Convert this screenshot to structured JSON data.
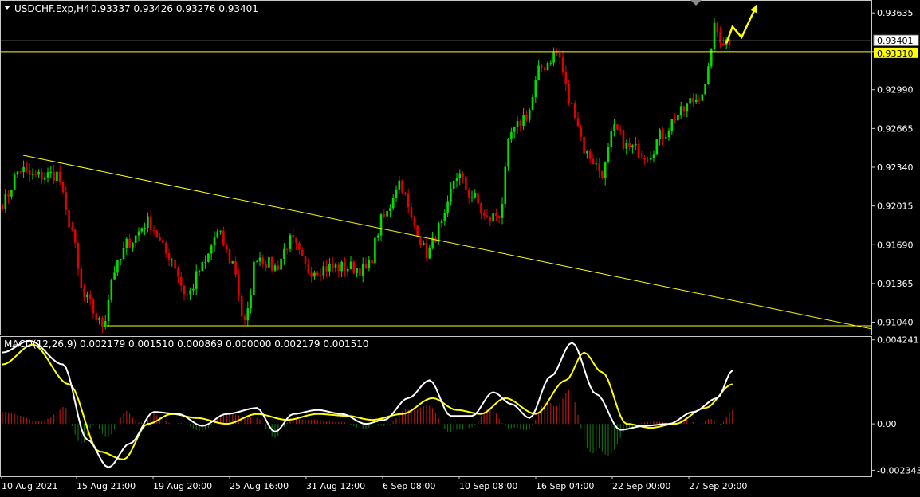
{
  "header": {
    "symbol": "USDCHF.Exp,H4",
    "ohlc": "0.93337 0.93426 0.93276 0.93401"
  },
  "colors": {
    "background": "#000000",
    "bull": "#00e000",
    "bear": "#e00000",
    "trend": "#ffff00",
    "grid": "#c8c8c8",
    "macd_line": "#ffffff",
    "signal_line": "#ffff00",
    "hist_pos": "#b01515",
    "hist_neg": "#0e6a0e"
  },
  "chart_data": [
    {
      "type": "candlestick",
      "name": "USDCHF.Exp,H4",
      "x_labels": [
        "10 Aug 2021",
        "15 Aug 21:00",
        "19 Aug 20:00",
        "25 Aug 16:00",
        "31 Aug 12:00",
        "6 Sep 08:00",
        "10 Sep 08:00",
        "16 Sep 04:00",
        "22 Sep 00:00",
        "27 Sep 20:00"
      ],
      "y_ticks": [
        "0.93635",
        "0.93310",
        "0.92990",
        "0.92665",
        "0.92340",
        "0.92015",
        "0.91690",
        "0.91365",
        "0.91040"
      ],
      "ylim": [
        0.9095,
        0.9373
      ],
      "bid_price": "0.93401",
      "level_price": "0.93310",
      "anchors": [
        [
          0,
          0.9205
        ],
        [
          6,
          0.9232
        ],
        [
          10,
          0.9226
        ],
        [
          18,
          0.9228
        ],
        [
          22,
          0.9188
        ],
        [
          27,
          0.9124
        ],
        [
          33,
          0.9102
        ],
        [
          37,
          0.9148
        ],
        [
          42,
          0.9172
        ],
        [
          48,
          0.9188
        ],
        [
          55,
          0.916
        ],
        [
          61,
          0.9127
        ],
        [
          66,
          0.915
        ],
        [
          71,
          0.9178
        ],
        [
          76,
          0.9154
        ],
        [
          80,
          0.9102
        ],
        [
          84,
          0.916
        ],
        [
          90,
          0.915
        ],
        [
          95,
          0.9172
        ],
        [
          101,
          0.9148
        ],
        [
          108,
          0.915
        ],
        [
          115,
          0.915
        ],
        [
          120,
          0.9148
        ],
        [
          126,
          0.9192
        ],
        [
          131,
          0.9222
        ],
        [
          136,
          0.9185
        ],
        [
          140,
          0.9162
        ],
        [
          145,
          0.9185
        ],
        [
          150,
          0.9228
        ],
        [
          155,
          0.921
        ],
        [
          160,
          0.919
        ],
        [
          164,
          0.9195
        ],
        [
          168,
          0.9262
        ],
        [
          173,
          0.9278
        ],
        [
          178,
          0.9318
        ],
        [
          183,
          0.933
        ],
        [
          188,
          0.9285
        ],
        [
          193,
          0.9245
        ],
        [
          198,
          0.923
        ],
        [
          202,
          0.9265
        ],
        [
          207,
          0.925
        ],
        [
          213,
          0.9245
        ],
        [
          218,
          0.9262
        ],
        [
          223,
          0.9278
        ],
        [
          228,
          0.929
        ],
        [
          232,
          0.93
        ],
        [
          235,
          0.935
        ],
        [
          238,
          0.934
        ],
        [
          240,
          0.934
        ]
      ],
      "pattern_arrow": [
        [
          239,
          0.9338
        ],
        [
          241,
          0.9352
        ],
        [
          244,
          0.9343
        ],
        [
          249,
          0.937
        ]
      ]
    },
    {
      "type": "macd",
      "title": "MACD(12,26,9) 0.002179 0.001510 0.000869 0.000000 0.002179 0.001510",
      "y_ticks": [
        "0.004241",
        "0.00",
        "-0.002343"
      ],
      "ylim": [
        -0.00265,
        0.00435
      ],
      "macd_anchors": [
        [
          0,
          0.0036
        ],
        [
          9,
          0.0042
        ],
        [
          20,
          0.003
        ],
        [
          28,
          -0.0008
        ],
        [
          35,
          -0.0022
        ],
        [
          42,
          -0.001
        ],
        [
          50,
          0.0006
        ],
        [
          58,
          0.0005
        ],
        [
          66,
          -0.0001
        ],
        [
          74,
          0.0005
        ],
        [
          84,
          0.0008
        ],
        [
          90,
          -0.0004
        ],
        [
          96,
          0.0005
        ],
        [
          104,
          0.0007
        ],
        [
          112,
          0.0005
        ],
        [
          120,
          0.0
        ],
        [
          126,
          0.0002
        ],
        [
          134,
          0.0013
        ],
        [
          141,
          0.0022
        ],
        [
          148,
          0.0004
        ],
        [
          155,
          0.0004
        ],
        [
          162,
          0.0016
        ],
        [
          168,
          0.001
        ],
        [
          174,
          0.0003
        ],
        [
          181,
          0.0024
        ],
        [
          188,
          0.0041
        ],
        [
          196,
          0.0015
        ],
        [
          204,
          -0.0003
        ],
        [
          212,
          -0.0001
        ],
        [
          220,
          0.0
        ],
        [
          228,
          0.0006
        ],
        [
          236,
          0.0013
        ],
        [
          241,
          0.0027
        ]
      ],
      "signal_anchors": [
        [
          0,
          0.003
        ],
        [
          10,
          0.004
        ],
        [
          22,
          0.002
        ],
        [
          32,
          -0.0014
        ],
        [
          40,
          -0.0018
        ],
        [
          48,
          0.0
        ],
        [
          56,
          0.0005
        ],
        [
          64,
          0.0003
        ],
        [
          74,
          0.0
        ],
        [
          84,
          0.0005
        ],
        [
          94,
          0.0002
        ],
        [
          104,
          0.0005
        ],
        [
          114,
          0.0004
        ],
        [
          122,
          0.0002
        ],
        [
          132,
          0.0005
        ],
        [
          142,
          0.0013
        ],
        [
          150,
          0.0007
        ],
        [
          158,
          0.0005
        ],
        [
          166,
          0.0013
        ],
        [
          176,
          0.0005
        ],
        [
          186,
          0.0022
        ],
        [
          192,
          0.0036
        ],
        [
          198,
          0.0026
        ],
        [
          206,
          0.0
        ],
        [
          214,
          -0.0002
        ],
        [
          222,
          0.0
        ],
        [
          232,
          0.0008
        ],
        [
          241,
          0.002
        ]
      ]
    }
  ]
}
